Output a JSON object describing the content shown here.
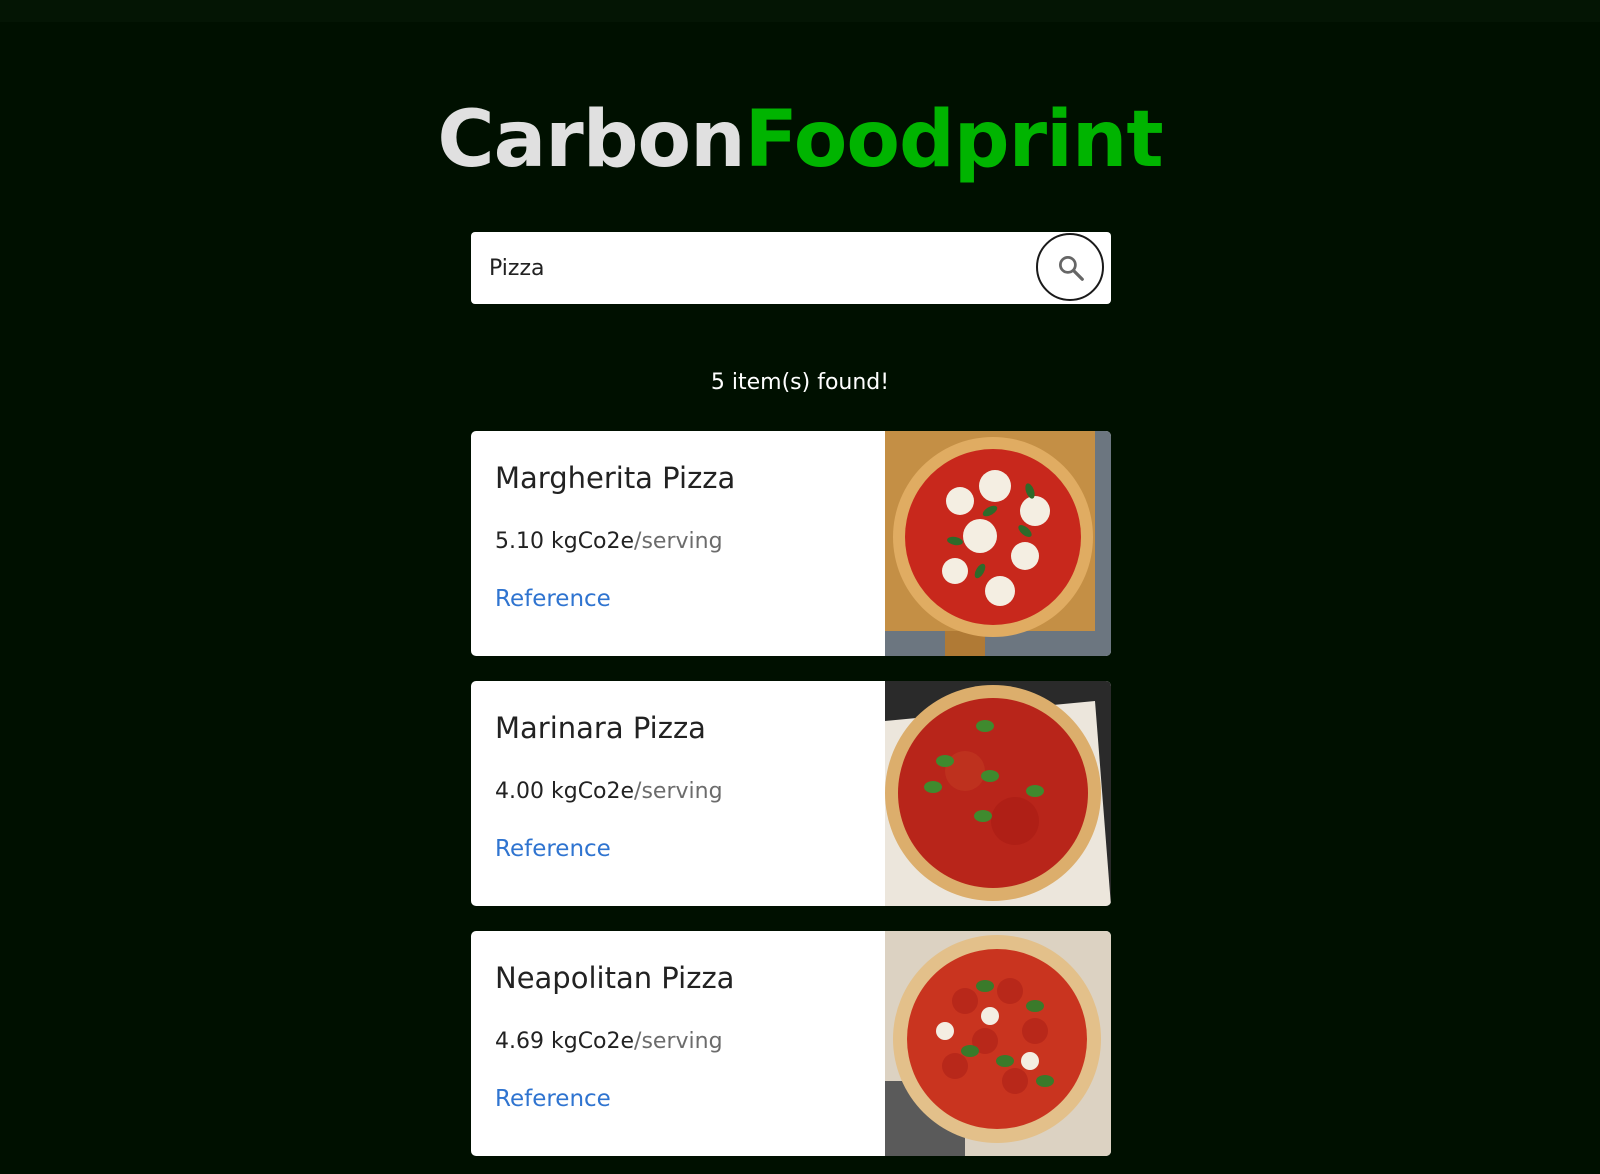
{
  "title": {
    "part1": "Carbon",
    "part2": "Foodprint"
  },
  "search": {
    "value": "Pizza",
    "button_icon": "search-icon"
  },
  "results_text": "5 item(s) found!",
  "colors": {
    "background": "#001000",
    "brand_green": "#00b400",
    "link": "#2f74d0"
  },
  "cards": [
    {
      "name": "Margherita Pizza",
      "value": "5.10",
      "unit": "kgCo2e",
      "per": "/serving",
      "link": "Reference",
      "image": "margherita-pizza-photo"
    },
    {
      "name": "Marinara Pizza",
      "value": "4.00",
      "unit": "kgCo2e",
      "per": "/serving",
      "link": "Reference",
      "image": "marinara-pizza-photo"
    },
    {
      "name": "Neapolitan Pizza",
      "value": "4.69",
      "unit": "kgCo2e",
      "per": "/serving",
      "link": "Reference",
      "image": "neapolitan-pizza-photo"
    }
  ]
}
